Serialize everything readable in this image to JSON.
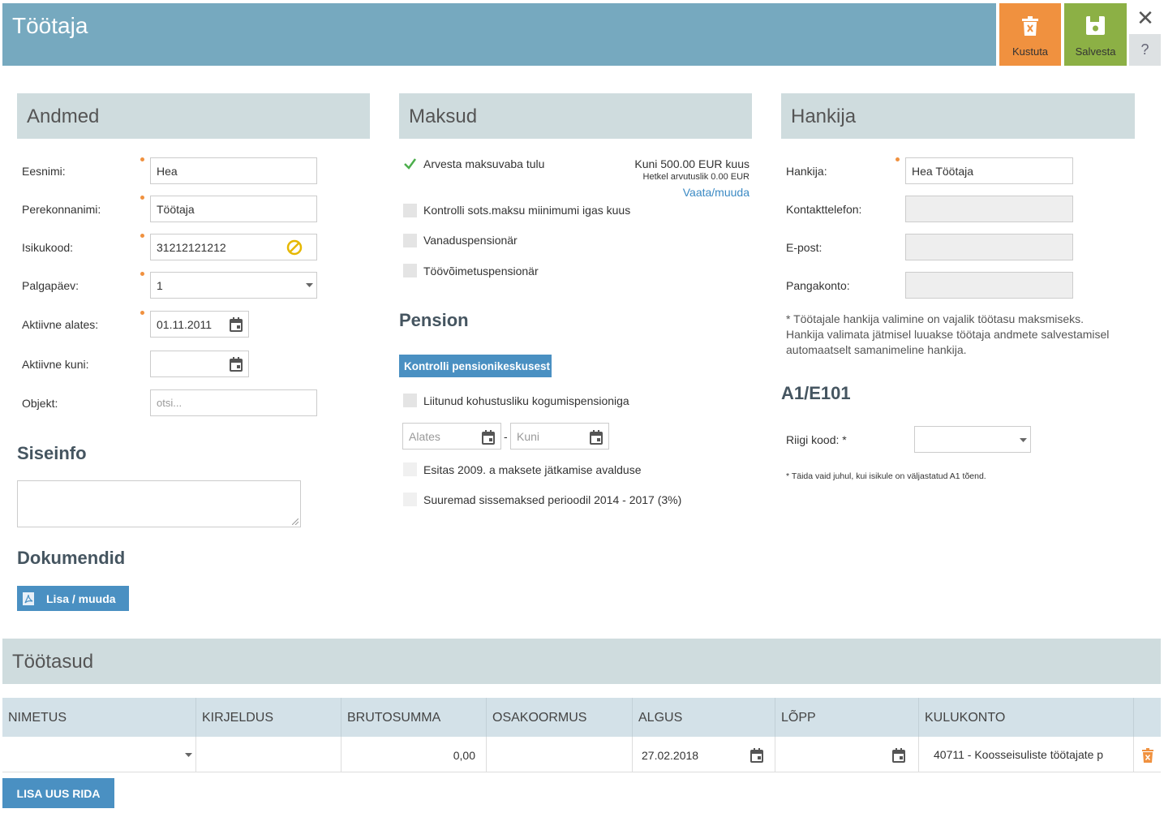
{
  "header": {
    "title": "Töötaja",
    "delete_label": "Kustuta",
    "save_label": "Salvesta",
    "close_icon": "close-icon",
    "help_label": "?"
  },
  "andmed": {
    "title": "Andmed",
    "fields": [
      {
        "label": "Eesnimi:",
        "value": "Hea"
      },
      {
        "label": "Perekonnanimi:",
        "value": "Töötaja"
      },
      {
        "label": "Isikukood:",
        "value": "31212121212"
      },
      {
        "label": "Palgapäev:",
        "value": "1"
      },
      {
        "label": "Aktiivne alates:",
        "value": "01.11.2011"
      },
      {
        "label": "Aktiivne kuni:",
        "value": ""
      },
      {
        "label": "Objekt:",
        "placeholder": "otsi..."
      }
    ],
    "siseinfo_title": "Siseinfo",
    "dokumendid_title": "Dokumendid",
    "dokumendid_button": "Lisa / muuda"
  },
  "maksud": {
    "title": "Maksud",
    "checks": [
      {
        "label": "Arvesta maksuvaba tulu",
        "checked": true
      },
      {
        "label": "Kontrolli sots.maksu miinimumi igas kuus",
        "checked": false
      },
      {
        "label": "Vanaduspensionär",
        "checked": false
      },
      {
        "label": "Töövõimetuspensionär",
        "checked": false
      }
    ],
    "limit_text": "Kuni 500.00 EUR kuus",
    "current_text": "Hetkel arvutuslik 0.00 EUR",
    "view_link": "Vaata/muuda",
    "pension_title": "Pension",
    "pension_button": "Kontrolli pensionikeskusest",
    "pension_check": "Liitunud kohustusliku kogumispensioniga",
    "from_placeholder": "Alates",
    "to_placeholder": "Kuni",
    "dash": "-",
    "extra_checks": [
      "Esitas 2009. a maksete jätkamise avalduse",
      "Suuremad sissemaksed perioodil 2014 - 2017 (3%)"
    ]
  },
  "hankija": {
    "title": "Hankija",
    "fields": [
      {
        "label": "Hankija:",
        "value": "Hea Töötaja"
      },
      {
        "label": "Kontakttelefon:",
        "value": ""
      },
      {
        "label": "E-post:",
        "value": ""
      },
      {
        "label": "Pangakonto:",
        "value": ""
      }
    ],
    "note_lines": [
      "* Töötajale hankija valimine on vajalik töötasu maksmiseks.",
      "Hankija valimata jätmisel luuakse töötaja andmete salvestamisel",
      "automaatselt samanimeline hankija."
    ],
    "a1_title": "A1/E101",
    "country_label": "Riigi kood: *",
    "country_note": "* Täida vaid juhul, kui isikule on väljastatud A1 tõend."
  },
  "tootasud": {
    "title": "Töötasud",
    "columns": [
      "NIMETUS",
      "KIRJELDUS",
      "BRUTOSUMMA",
      "OSAKOORMUS",
      "ALGUS",
      "LÕPP",
      "KULUKONTO"
    ],
    "row": {
      "nimetus": "",
      "kirjeldus": "",
      "brutosumma": "0,00",
      "osakoormus": "",
      "algus": "27.02.2018",
      "lopp": "",
      "kulukonto": "40711 - Koosseisuliste töötajate p"
    },
    "add_button": "LISA UUS RIDA"
  },
  "colors": {
    "header": "#76a9bf",
    "delete": "#f0913f",
    "save": "#8cb045",
    "section": "#cfdcde",
    "button": "#4a90c2"
  }
}
